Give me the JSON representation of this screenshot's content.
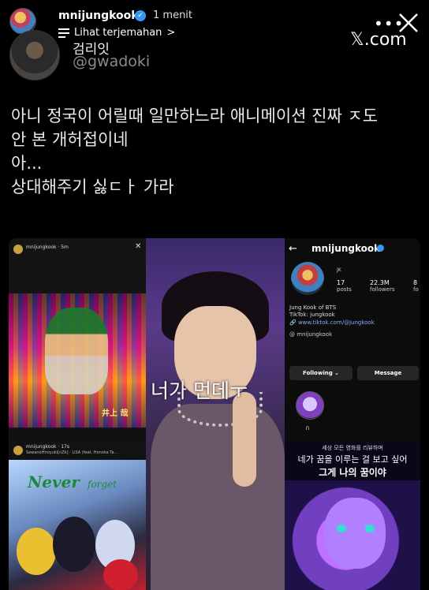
{
  "story": {
    "username": "mnijungkook",
    "time": "1 menit",
    "translate_label": "Lihat terjemahan",
    "translate_chevron": ">",
    "more_icon": "more-dots-icon",
    "close_icon": "close-x-icon"
  },
  "tweet": {
    "display_name": "검리잇",
    "handle": "@gwadoki",
    "watermark": "𝕏.com",
    "lines": [
      "아니 정국이 어릴때 일만하느라 애니메이션 진짜 ㅈ도",
      "안 본 개허접이네",
      "아...",
      "상대해주기 싫ㄷㅏ 가라"
    ]
  },
  "collage": {
    "panel1": {
      "user": "mnijungkook",
      "time": "5m",
      "subtitle": "井上 哉"
    },
    "panel2": {
      "user": "mnijungkook",
      "time": "17s",
      "song": "SawanoHiroyuki[nZk] · LiSA (feat. Honoka Ta...",
      "title": "Never",
      "title2": "forget"
    },
    "panel3": {
      "caption": "너가 먼데ㅜ"
    },
    "panel4": {
      "back": "←",
      "username": "mnijungkook",
      "avatar_label": "JK",
      "stats": [
        {
          "value": "17",
          "label": "posts"
        },
        {
          "value": "22.3M",
          "label": "followers"
        },
        {
          "value": "8",
          "label": "fo"
        }
      ],
      "bio_line1": "Jung Kook of BTS",
      "bio_line2": "TikTok: jungkook",
      "link": "www.tiktok.com/@jungkook",
      "threads": "mnijungkook",
      "following_button": "Following ⌄",
      "message_button": "Message",
      "highlight_icon": "∩"
    },
    "panel5": {
      "line1": "세상 모든 영화를 리뷰하며",
      "line2": "네가 꿈을 이루는 걸 보고 싶어",
      "line3": "그게 나의 꿈이야"
    }
  },
  "colors": {
    "background": "#000000",
    "verified": "#3897f0",
    "handle": "#8b8b8b"
  }
}
